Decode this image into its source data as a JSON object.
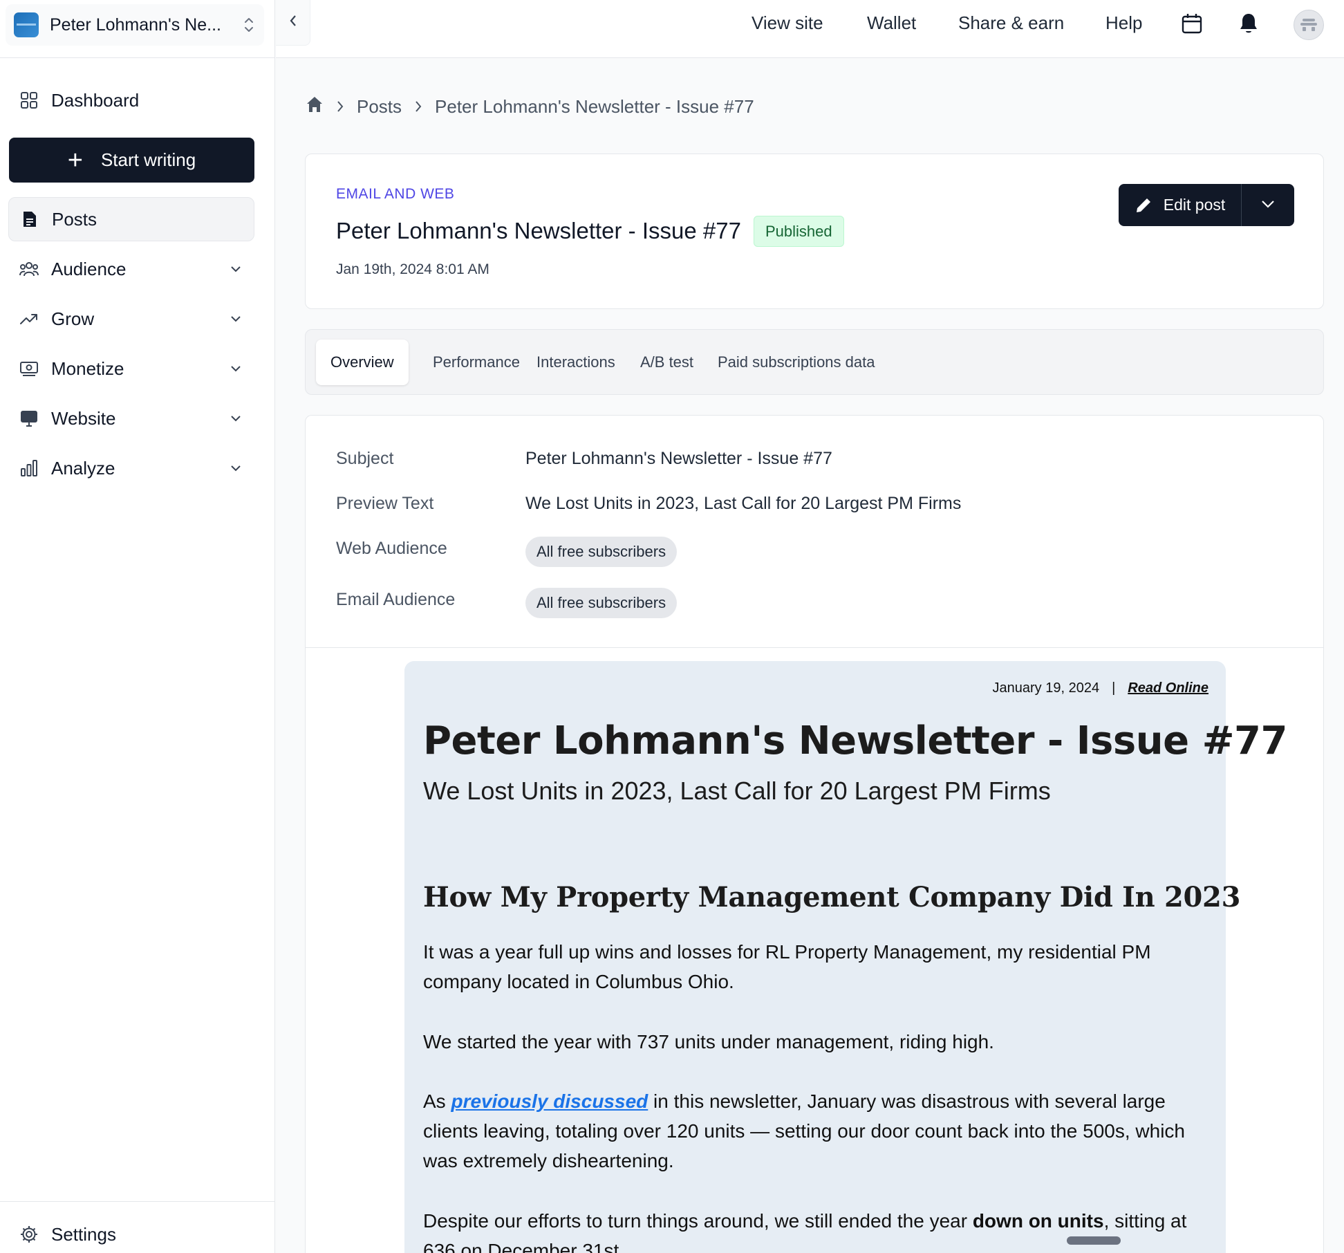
{
  "publication": {
    "name": "Peter Lohmann's Ne..."
  },
  "sidebar": {
    "dashboard": "Dashboard",
    "start_writing": "Start writing",
    "items": [
      {
        "label": "Posts",
        "icon": "document-icon"
      },
      {
        "label": "Audience",
        "icon": "users-icon"
      },
      {
        "label": "Grow",
        "icon": "trending-up-icon"
      },
      {
        "label": "Monetize",
        "icon": "cash-icon"
      },
      {
        "label": "Website",
        "icon": "monitor-icon"
      },
      {
        "label": "Analyze",
        "icon": "bar-chart-icon"
      }
    ],
    "settings": "Settings"
  },
  "topbar": {
    "links": [
      "View site",
      "Wallet",
      "Share & earn",
      "Help"
    ]
  },
  "breadcrumb": {
    "section": "Posts",
    "current": "Peter Lohmann's Newsletter - Issue #77"
  },
  "post": {
    "type": "EMAIL AND WEB",
    "title": "Peter Lohmann's Newsletter - Issue #77",
    "status": "Published",
    "date": "Jan 19th, 2024 8:01 AM",
    "edit_label": "Edit post"
  },
  "tabs": [
    "Overview",
    "Performance",
    "Interactions",
    "A/B test",
    "Paid subscriptions data"
  ],
  "details": {
    "subject_label": "Subject",
    "subject": "Peter Lohmann's Newsletter - Issue #77",
    "preview_label": "Preview Text",
    "preview": "We Lost Units in 2023, Last Call for 20 Largest PM Firms",
    "web_audience_label": "Web Audience",
    "web_audience": "All free subscribers",
    "email_audience_label": "Email Audience",
    "email_audience": "All free subscribers"
  },
  "email": {
    "date": "January 19, 2024",
    "separator": "|",
    "read_online": "Read Online",
    "title": "Peter Lohmann's Newsletter - Issue #77",
    "subtitle": "We Lost Units in 2023, Last Call for 20 Largest PM Firms",
    "heading": "How My Property Management Company Did In 2023",
    "p1": "It was a year full up wins and losses for RL Property Management, my residential PM company located in Columbus Ohio.",
    "p2": "We started the year with 737 units under management, riding high.",
    "p3_pre": "As ",
    "p3_link": "previously discussed",
    "p3_post": " in this newsletter, January was disastrous with several large clients leaving, totaling over 120 units — setting our door count back into the 500s, which was extremely disheartening.",
    "p4_pre": "Despite our efforts to turn things around, we still ended the year ",
    "p4_bold": "down on units",
    "p4_post": ", sitting at 636 on December 31st."
  }
}
